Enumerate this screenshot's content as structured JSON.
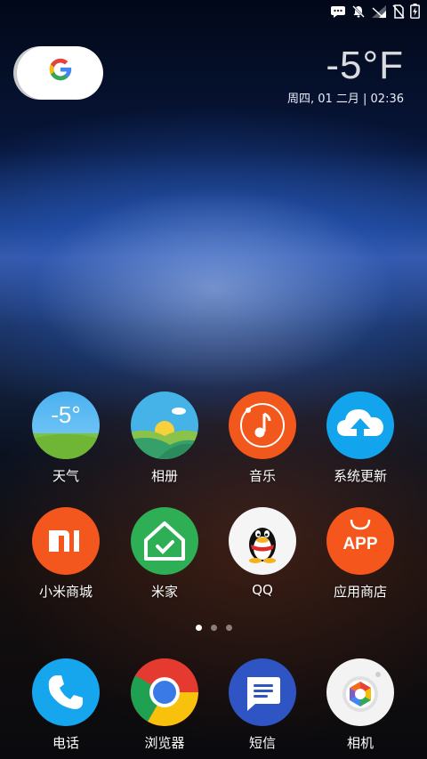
{
  "status_bar": {
    "icons": [
      "message-icon",
      "mute-icon",
      "wifi-icon",
      "no-sim-icon",
      "battery-charging-icon"
    ]
  },
  "google_widget": {
    "letter": "G",
    "colors": [
      "#4285F4",
      "#EA4335",
      "#FBBC05",
      "#34A853"
    ]
  },
  "clock_widget": {
    "temperature": "-5°F",
    "date_time": "周四, 01 二月 | 02:36"
  },
  "apps": [
    {
      "label": "天气",
      "icon": "weather-icon",
      "weather_temp": "-5°"
    },
    {
      "label": "相册",
      "icon": "gallery-icon"
    },
    {
      "label": "音乐",
      "icon": "music-icon"
    },
    {
      "label": "系统更新",
      "icon": "system-update-icon"
    },
    {
      "label": "小米商城",
      "icon": "mi-store-icon",
      "mi_text": "MI"
    },
    {
      "label": "米家",
      "icon": "mi-home-icon"
    },
    {
      "label": "QQ",
      "icon": "qq-icon"
    },
    {
      "label": "应用商店",
      "icon": "app-store-icon",
      "app_text": "APP"
    }
  ],
  "page_indicator": {
    "pages": 3,
    "current": 1
  },
  "dock": [
    {
      "label": "电话",
      "icon": "phone-icon"
    },
    {
      "label": "浏览器",
      "icon": "browser-icon"
    },
    {
      "label": "短信",
      "icon": "messages-icon"
    },
    {
      "label": "相机",
      "icon": "camera-icon"
    }
  ]
}
